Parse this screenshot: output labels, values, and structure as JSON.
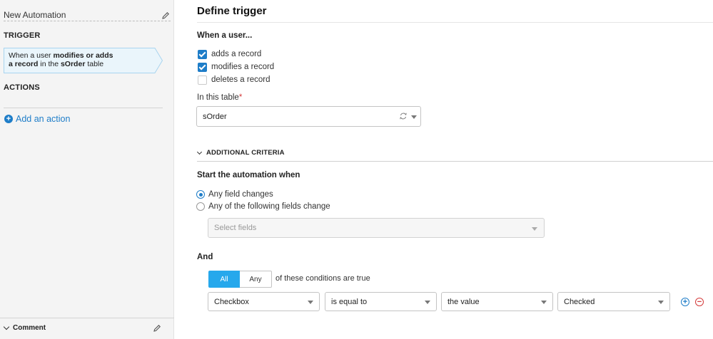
{
  "sidebar": {
    "automation_name": "New Automation",
    "trigger_heading": "TRIGGER",
    "trigger_card": {
      "line1_pre": "When a user ",
      "line1_bold": "modifies or adds",
      "line2_bold1": "a record",
      "line2_mid": " in the ",
      "line2_bold2": "sOrder",
      "line2_post": " table"
    },
    "actions_heading": "ACTIONS",
    "add_action_label": "Add an action",
    "comment_heading": "Comment"
  },
  "main": {
    "title": "Define trigger",
    "when_user": "When a user...",
    "checks": [
      {
        "label": "adds a record",
        "checked": true
      },
      {
        "label": "modifies a record",
        "checked": true
      },
      {
        "label": "deletes a record",
        "checked": false
      }
    ],
    "table_label": "In this table",
    "required_mark": "*",
    "table_value": "sOrder",
    "criteria_heading": "ADDITIONAL CRITERIA",
    "start_when": "Start the automation when",
    "radios": [
      {
        "label": "Any field changes",
        "selected": true
      },
      {
        "label": "Any of the following fields change",
        "selected": false
      }
    ],
    "fields_placeholder": "Select fields",
    "and_label": "And",
    "toggle": {
      "all": "All",
      "any": "Any",
      "selected": "All"
    },
    "conditions_text": "of these conditions are true",
    "condition": {
      "field": "Checkbox",
      "operator": "is equal to",
      "value_type": "the value",
      "value": "Checked"
    }
  },
  "colors": {
    "accent": "#1e7dc8",
    "toggle_active": "#26a8ec",
    "required": "#d43b3b"
  }
}
